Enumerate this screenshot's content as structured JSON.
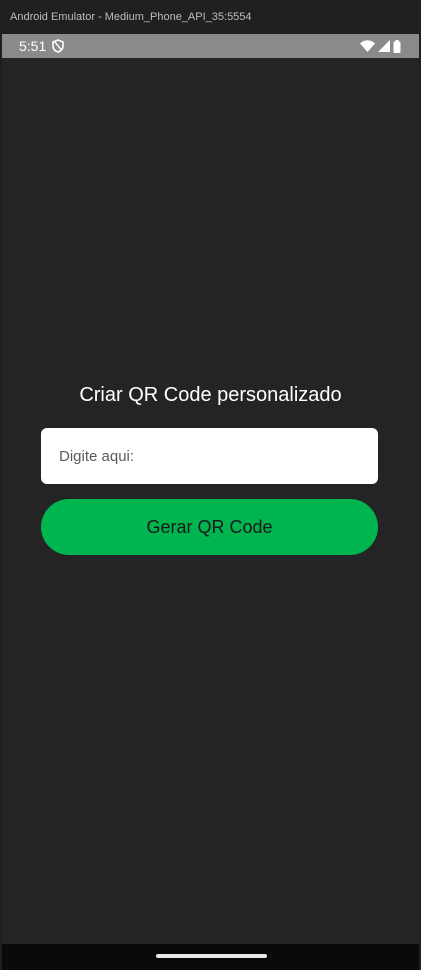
{
  "window": {
    "title": "Android Emulator - Medium_Phone_API_35:5554"
  },
  "statusbar": {
    "time": "5:51",
    "icons": [
      "shield-icon",
      "wifi-icon",
      "signal-icon",
      "battery-icon"
    ]
  },
  "screen": {
    "title": "Criar QR Code personalizado",
    "input": {
      "placeholder": "Digite aqui:",
      "value": ""
    },
    "button_label": "Gerar QR Code"
  },
  "colors": {
    "background": "#242424",
    "button": "#00b44f",
    "input_bg": "#ffffff",
    "text": "#ffffff"
  }
}
